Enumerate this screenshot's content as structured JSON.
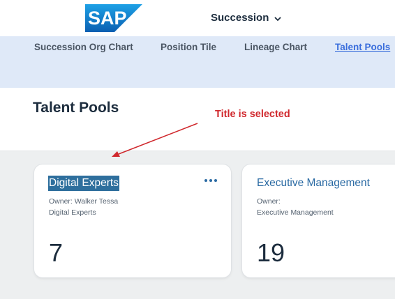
{
  "brand": {
    "logo_text": "SAP",
    "logo_color": "#1a73c8"
  },
  "module_switcher": {
    "label": "Succession",
    "icon": "chevron-down-icon"
  },
  "nav_tabs": [
    {
      "label": "Succession Org Chart",
      "active": false
    },
    {
      "label": "Position Tile",
      "active": false
    },
    {
      "label": "Lineage Chart",
      "active": false
    },
    {
      "label": "Talent Pools",
      "active": true
    }
  ],
  "page": {
    "title": "Talent Pools"
  },
  "annotation": {
    "text": "Title is selected",
    "color": "#d0282d"
  },
  "cards": [
    {
      "title": "Digital Experts",
      "title_selected": true,
      "owner_line": "Owner: Walker Tessa",
      "subtext": "Digital Experts",
      "count": "7",
      "has_menu": true
    },
    {
      "title": "Executive Management",
      "title_selected": false,
      "owner_line": "Owner:",
      "subtext": "Executive Management",
      "count": "19",
      "has_menu": false
    }
  ],
  "colors": {
    "accent": "#2a6aa3",
    "selection": "#2e6f9d",
    "tabs_bg": "#dfe9f8",
    "active_tab": "#3a6edc"
  }
}
